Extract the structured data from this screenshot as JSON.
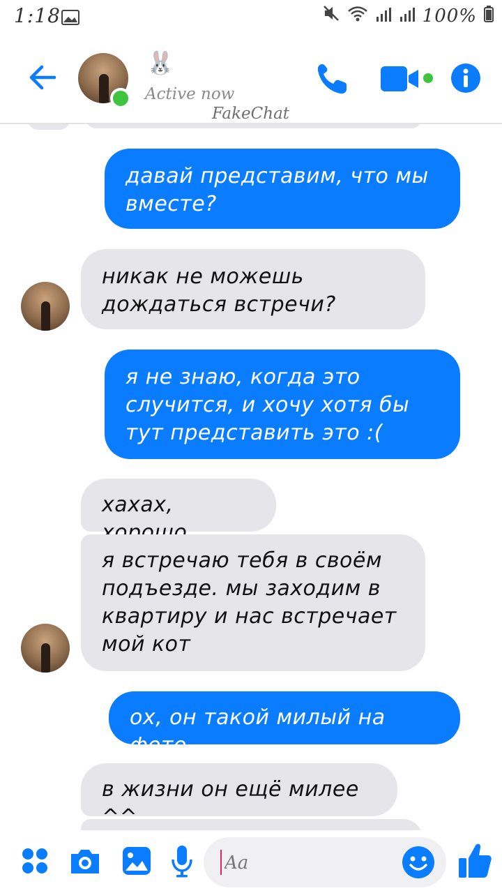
{
  "status_bar": {
    "time": "1:18",
    "battery": "100%"
  },
  "header": {
    "contact_emoji": "🐰",
    "active_status": "Active now",
    "watermark": "FakeChat"
  },
  "messages": [
    {
      "side": "out",
      "text_lines": [
        "давай представим, что мы",
        "вместе?"
      ]
    },
    {
      "side": "in",
      "text_lines": [
        "никак не можешь",
        "дождаться встречи?"
      ]
    },
    {
      "side": "out",
      "text_lines": [
        "я не знаю, когда это",
        "случится, и хочу хотя бы",
        "тут представить это :("
      ]
    },
    {
      "side": "in",
      "text_lines": [
        "хахах, хорошо"
      ]
    },
    {
      "side": "in",
      "text_lines": [
        "я встречаю тебя в своём",
        "подъезде. мы заходим в",
        "квартиру и нас встречает",
        "мой кот"
      ]
    },
    {
      "side": "out",
      "text_lines": [
        "ох, он такой милый на фото"
      ]
    },
    {
      "side": "in",
      "text_lines": [
        "в жизни он ещё милее ^^"
      ]
    }
  ],
  "composer": {
    "placeholder": "Aa"
  },
  "colors": {
    "accent": "#0a7cff",
    "incoming_bubble": "#e6e6ea",
    "online": "#3fc43f"
  },
  "icons": {
    "header": [
      "back-arrow-icon",
      "phone-icon",
      "video-camera-icon",
      "info-icon"
    ],
    "composer": [
      "apps-icon",
      "camera-icon",
      "gallery-icon",
      "microphone-icon",
      "emoji-icon",
      "thumbs-up-icon"
    ]
  }
}
